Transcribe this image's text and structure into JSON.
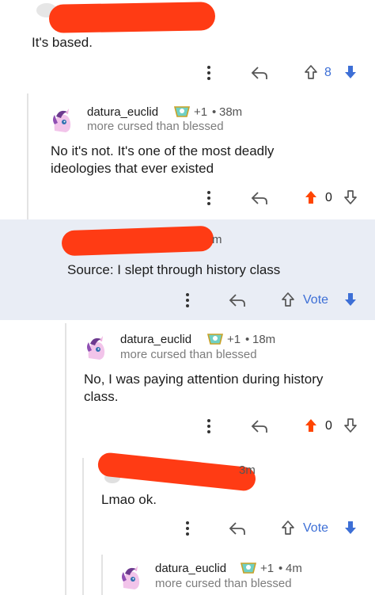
{
  "comments": [
    {
      "body": "It's based.",
      "votes": "8"
    },
    {
      "user": "datura_euclid",
      "karma": "+1",
      "sep": "•",
      "age": "38m",
      "flair": "more cursed than blessed",
      "body_lines": [
        "No it's not. It's one of the most deadly",
        "ideologies that ever existed"
      ],
      "votes": "0"
    },
    {
      "body": "Source: I slept through history class",
      "age_fragment": "m",
      "vote_label": "Vote"
    },
    {
      "user": "datura_euclid",
      "karma": "+1",
      "sep": "•",
      "age": "18m",
      "flair": "more cursed than blessed",
      "body_lines": [
        "No, I was paying attention during history",
        "class."
      ],
      "votes": "0"
    },
    {
      "body": "Lmao ok.",
      "age_fragment": "3m",
      "vote_label": "Vote"
    },
    {
      "user": "datura_euclid",
      "karma": "+1",
      "sep": "•",
      "age": "4m",
      "flair": "more cursed than blessed"
    }
  ],
  "colors": {
    "accent_blue": "#3d6fd6",
    "upvote_orange": "#ff4500",
    "redaction": "#ff3b14",
    "highlight_bg": "#e9edf5"
  },
  "icons": [
    "more-vertical-icon",
    "reply-icon",
    "upvote-icon",
    "downvote-icon",
    "award-flair-icon",
    "pony-avatar-icon"
  ]
}
